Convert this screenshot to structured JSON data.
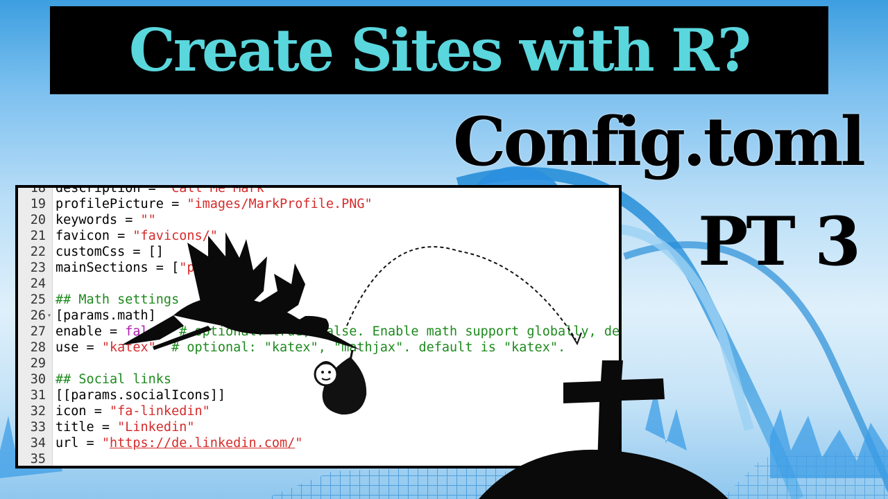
{
  "banner": {
    "title": "Create Sites with R?"
  },
  "subtitle": "Config.toml",
  "part": "PT 3",
  "editor": {
    "lines": [
      {
        "num": "18",
        "tokens": [
          {
            "t": "description = ",
            "c": "plain"
          },
          {
            "t": "\"Call Me Mark\"",
            "c": "str"
          }
        ]
      },
      {
        "num": "19",
        "tokens": [
          {
            "t": "profilePicture = ",
            "c": "plain"
          },
          {
            "t": "\"images/MarkProfile.PNG\"",
            "c": "str"
          }
        ]
      },
      {
        "num": "20",
        "tokens": [
          {
            "t": "keywords = ",
            "c": "plain"
          },
          {
            "t": "\"\"",
            "c": "str"
          }
        ]
      },
      {
        "num": "21",
        "tokens": [
          {
            "t": "favicon = ",
            "c": "plain"
          },
          {
            "t": "\"favicons/\"",
            "c": "str"
          }
        ]
      },
      {
        "num": "22",
        "tokens": [
          {
            "t": "customCss = []",
            "c": "plain"
          }
        ]
      },
      {
        "num": "23",
        "tokens": [
          {
            "t": "mainSections = [",
            "c": "plain"
          },
          {
            "t": "\"post\"",
            "c": "str"
          },
          {
            "t": "]",
            "c": "plain"
          }
        ]
      },
      {
        "num": "24",
        "tokens": []
      },
      {
        "num": "25",
        "tokens": [
          {
            "t": "## Math settings",
            "c": "com"
          }
        ]
      },
      {
        "num": "26",
        "fold": "▾",
        "tokens": [
          {
            "t": "[params.math]",
            "c": "plain"
          }
        ]
      },
      {
        "num": "27",
        "tokens": [
          {
            "t": "enable = ",
            "c": "plain"
          },
          {
            "t": "false",
            "c": "kw"
          },
          {
            "t": "  # optional: true, false. Enable math support globally, default: false.",
            "c": "com"
          }
        ]
      },
      {
        "num": "28",
        "tokens": [
          {
            "t": "use = ",
            "c": "plain"
          },
          {
            "t": "\"katex\"",
            "c": "str"
          },
          {
            "t": "  # optional: \"katex\", \"mathjax\". default is \"katex\".",
            "c": "com"
          }
        ]
      },
      {
        "num": "29",
        "tokens": []
      },
      {
        "num": "30",
        "tokens": [
          {
            "t": "## Social links",
            "c": "com"
          }
        ]
      },
      {
        "num": "31",
        "tokens": [
          {
            "t": "[[params.socialIcons]]",
            "c": "plain"
          }
        ]
      },
      {
        "num": "32",
        "tokens": [
          {
            "t": "icon = ",
            "c": "plain"
          },
          {
            "t": "\"fa-linkedin\"",
            "c": "str"
          }
        ]
      },
      {
        "num": "33",
        "tokens": [
          {
            "t": "title = ",
            "c": "plain"
          },
          {
            "t": "\"Linkedin\"",
            "c": "str"
          }
        ]
      },
      {
        "num": "34",
        "tokens": [
          {
            "t": "url = ",
            "c": "plain"
          },
          {
            "t": "\"",
            "c": "str"
          },
          {
            "t": "https://de.linkedin.com/",
            "c": "url"
          },
          {
            "t": "\"",
            "c": "str"
          }
        ]
      },
      {
        "num": "35",
        "tokens": []
      }
    ]
  },
  "icons": [
    "stork-silhouette-icon",
    "baby-bundle-icon",
    "dashed-arc-arrow-icon",
    "grave-cross-icon"
  ],
  "colors": {
    "title_text": "#5ad6dd",
    "banner_bg": "#000000",
    "string": "#d62b2b",
    "comment": "#1d8a1d",
    "keyword": "#b11bb1"
  }
}
